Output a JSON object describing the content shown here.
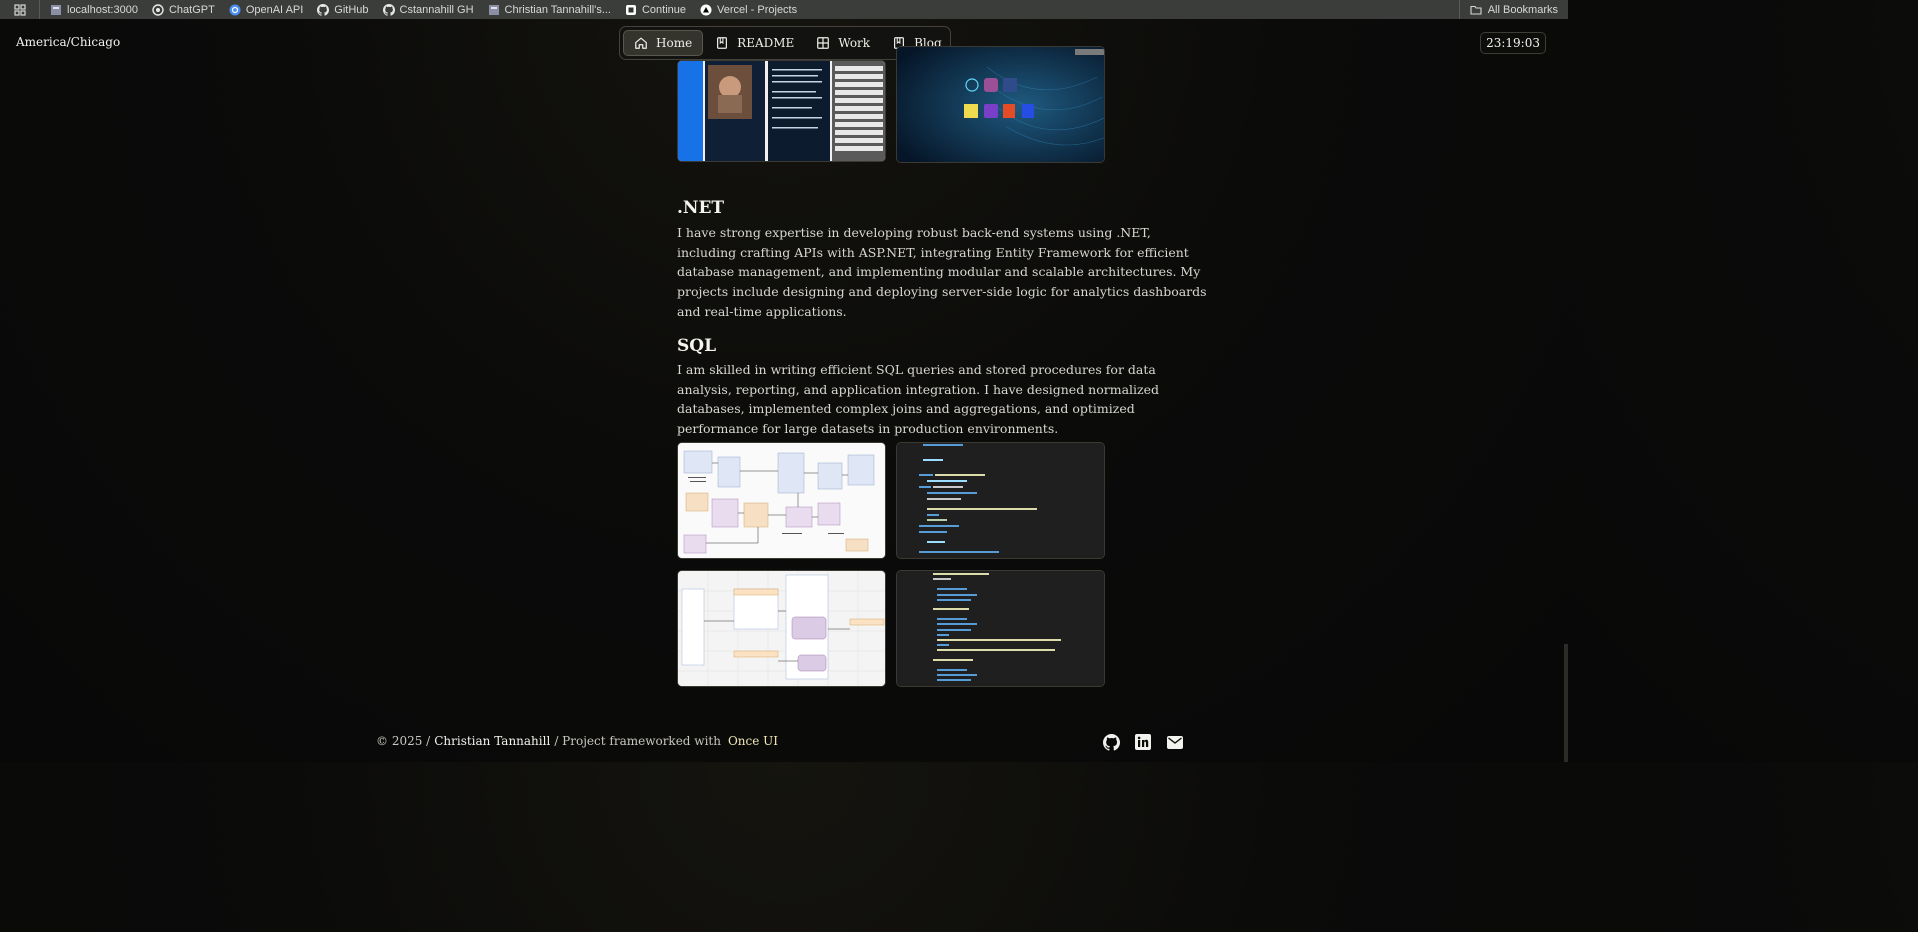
{
  "bookmarks": [
    {
      "label": "localhost:3000",
      "icon": "page-icon"
    },
    {
      "label": "ChatGPT",
      "icon": "openai-icon"
    },
    {
      "label": "OpenAI API",
      "icon": "openai-api-icon"
    },
    {
      "label": "GitHub",
      "icon": "github-icon"
    },
    {
      "label": "Cstannahill GH",
      "icon": "github-icon"
    },
    {
      "label": "Christian Tannahill's...",
      "icon": "page-icon"
    },
    {
      "label": "Continue",
      "icon": "continue-icon"
    },
    {
      "label": "Vercel - Projects",
      "icon": "vercel-icon"
    }
  ],
  "all_bookmarks": "All Bookmarks",
  "header": {
    "timezone": "America/Chicago",
    "time": "23:19:03",
    "nav": [
      {
        "label": "Home",
        "icon": "home-icon",
        "active": true
      },
      {
        "label": "README",
        "icon": "book-icon",
        "active": false
      },
      {
        "label": "Work",
        "icon": "grid-icon",
        "active": false
      },
      {
        "label": "Blog",
        "icon": "book-icon",
        "active": false
      }
    ]
  },
  "sections": [
    {
      "title": ".NET",
      "body": "I have strong expertise in developing robust back-end systems using .NET, including crafting APIs with ASP.NET, integrating Entity Framework for efficient database management, and implementing modular and scalable architectures. My projects include designing and deploying server-side logic for analytics dashboards and real-time applications."
    },
    {
      "title": "SQL",
      "body": "I am skilled in writing efficient SQL queries and stored procedures for data analysis, reporting, and application integration. I have designed normalized databases, implemented complex joins and aggregations, and optimized performance for large datasets in production environments."
    }
  ],
  "footer": {
    "copyright": "© 2025 /",
    "author": "Christian Tannahill",
    "middle": "/ Project frameworked with",
    "framework": "Once UI"
  },
  "socials": [
    "github-icon",
    "linkedin-icon",
    "email-icon"
  ],
  "colors": {
    "accent": "#f0e7b8",
    "background": "#0b0b0a",
    "bookmark_bar": "#3b3d3b"
  }
}
